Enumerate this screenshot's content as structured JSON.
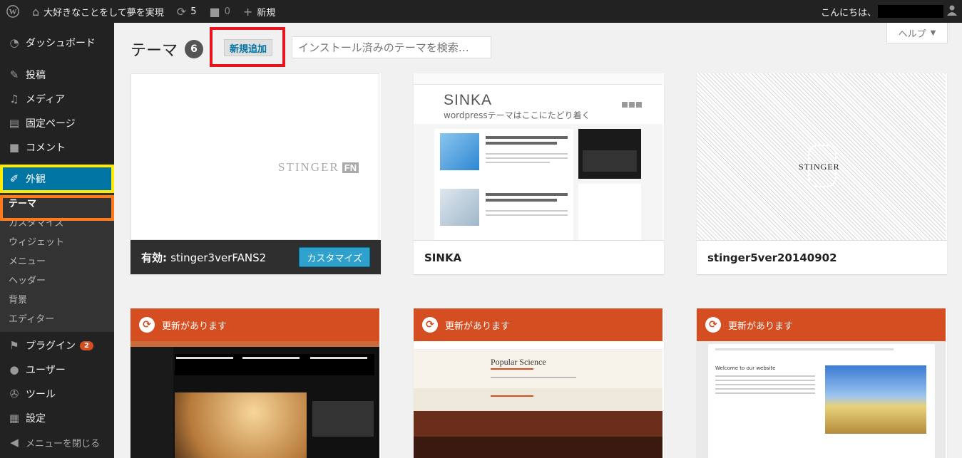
{
  "adminbar": {
    "site_name": "大好きなことをして夢を実現",
    "updates_count": "5",
    "comments_count": "0",
    "new_label": "新規",
    "greeting": "こんにちは、"
  },
  "sidebar": {
    "dashboard": "ダッシュボード",
    "posts": "投稿",
    "media": "メディア",
    "pages": "固定ページ",
    "comments": "コメント",
    "appearance": "外観",
    "sub": {
      "themes": "テーマ",
      "customize": "カスタマイズ",
      "widgets": "ウィジェット",
      "menus": "メニュー",
      "header": "ヘッダー",
      "background": "背景",
      "editor": "エディター"
    },
    "plugins": "プラグイン",
    "plugins_badge": "2",
    "users": "ユーザー",
    "tools": "ツール",
    "settings": "設定",
    "collapse": "メニューを閉じる"
  },
  "page": {
    "title": "テーマ",
    "theme_count": "6",
    "add_new": "新規追加",
    "search_placeholder": "インストール済みのテーマを検索…",
    "help": "ヘルプ"
  },
  "themes": {
    "active_prefix": "有効:",
    "active_name": "stinger3verFANS2",
    "customize": "カスタマイズ",
    "active_logo": "STINGER",
    "active_logo_suffix": "FN",
    "sinka": "SINKA",
    "sinka_title": "SINKA",
    "sinka_tagline": "wordpressテーマはここにたどり着く",
    "stinger5": "stinger5ver20140902",
    "stinger5_logo": "STINGER",
    "update_notice": "更新があります",
    "popsci_title": "Popular Science",
    "welcome_title": "Welcome to our website"
  },
  "colors": {
    "admin_bar": "#222222",
    "sidebar": "#222222",
    "active_menu": "#0074a2",
    "update_bar": "#d54e21",
    "highlight_yellow": "#ffeb00",
    "highlight_orange": "#ff7b1c",
    "highlight_red": "#e8151e"
  }
}
